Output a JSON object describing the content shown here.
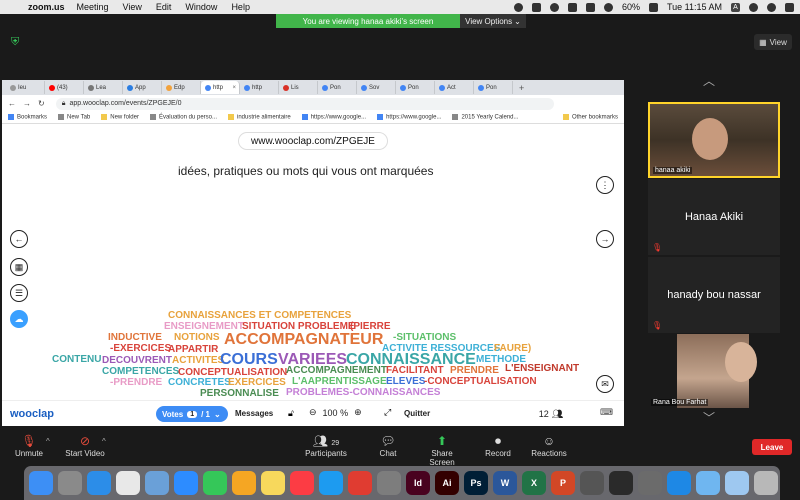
{
  "menubar": {
    "app": "zoom.us",
    "items": [
      "Meeting",
      "View",
      "Edit",
      "Window",
      "Help"
    ],
    "battery": "60%",
    "clock": "Tue 11:15 AM"
  },
  "zoom": {
    "share_banner": "You are viewing hanaa akiki's screen",
    "view_options": "View Options",
    "view_button": "View",
    "participants_count": "29",
    "controls": {
      "unmute": "Unmute",
      "start_video": "Start Video",
      "participants": "Participants",
      "chat": "Chat",
      "share_screen": "Share Screen",
      "record": "Record",
      "reactions": "Reactions",
      "leave": "Leave"
    },
    "tiles": [
      {
        "name": "hanaa akiki"
      },
      {
        "name": "Hanaa Akiki"
      },
      {
        "name": "hanady bou nassar"
      },
      {
        "name": "Rana Bou Farhat"
      }
    ]
  },
  "browser": {
    "tabs": [
      "(43)",
      "Lea",
      "App",
      "Edp",
      "http",
      "http",
      "Lis",
      "Pon",
      "Sov",
      "Pon",
      "Act",
      "Pon"
    ],
    "first_tab": "Ieu",
    "url": "app.wooclap.com/events/ZPGEJE/0",
    "bookmarks": [
      "Bookmarks",
      "New Tab",
      "New folder",
      "Évaluation du perso...",
      "industrie alimentaire",
      "https://www.google...",
      "https://www.google...",
      "2015 Yearly Calend..."
    ],
    "other_bookmarks": "Other bookmarks"
  },
  "wooclap": {
    "pill_url": "www.wooclap.com/ZPGEJE",
    "question": "idées, pratiques ou mots qui vous ont marquées",
    "logo": "wooclap",
    "votes_label": "Votes",
    "page_current": "1",
    "page_total": "/ 1",
    "messages": "Messages",
    "zoom_level": "100 %",
    "quit": "Quitter",
    "participants": "12"
  },
  "wordcloud": [
    {
      "text": "CONNAISSANCES ET COMPETENCES",
      "color": "#e8a23c"
    },
    {
      "text": "ENSEIGNEMENT",
      "color": "#e89bc6"
    },
    {
      "text": "SITUATION PROBLEME",
      "color": "#d8433b"
    },
    {
      "text": "(PIERRE",
      "color": "#d8433b"
    },
    {
      "text": "INDUCTIVE",
      "color": "#e0743a"
    },
    {
      "text": "NOTIONS",
      "color": "#e8a23c"
    },
    {
      "text": "ACCOMPAGNATEUR",
      "color": "#e0743a"
    },
    {
      "text": "-SITUATIONS",
      "color": "#5cbf6a"
    },
    {
      "text": "-EXERCICES",
      "color": "#d8433b"
    },
    {
      "text": "APPARTIR",
      "color": "#d8433b"
    },
    {
      "text": "ACTIVITE RESSOURCES",
      "color": "#3db0d6"
    },
    {
      "text": "FAURE)",
      "color": "#e8a23c"
    },
    {
      "text": "CONTENU",
      "color": "#3aa6a6"
    },
    {
      "text": "DECOUVRENT",
      "color": "#9b59b6"
    },
    {
      "text": "ACTIVITES",
      "color": "#e8a23c"
    },
    {
      "text": "COURS",
      "color": "#3b6fd6"
    },
    {
      "text": "VARIEES",
      "color": "#9b59b6"
    },
    {
      "text": "CONNAISSANCE",
      "color": "#3aa6a6"
    },
    {
      "text": "METHODE",
      "color": "#3db0d6"
    },
    {
      "text": "COMPETENCES",
      "color": "#3aa6a6"
    },
    {
      "text": "CONCEPTUALISATION",
      "color": "#d8433b"
    },
    {
      "text": "ACCOMPAGNEMENT",
      "color": "#4a8c52"
    },
    {
      "text": "FACILITANT",
      "color": "#d8433b"
    },
    {
      "text": "PRENDRE",
      "color": "#e0743a"
    },
    {
      "text": "L'ENSEIGNANT",
      "color": "#c0392b"
    },
    {
      "text": "-PRENDRE",
      "color": "#e89bc6"
    },
    {
      "text": "CONCRETES",
      "color": "#3db0d6"
    },
    {
      "text": "EXERCICES",
      "color": "#e8a23c"
    },
    {
      "text": "L'AAPRENTISSAGE",
      "color": "#5cbf6a"
    },
    {
      "text": "ELEVES",
      "color": "#3b6fd6"
    },
    {
      "text": "-CONCEPTUALISATION",
      "color": "#d8433b"
    },
    {
      "text": "PERSONNALISE",
      "color": "#4a8c52"
    },
    {
      "text": "PROBLEMES-CONNAISSANCES",
      "color": "#c47fd6"
    }
  ],
  "dock": [
    {
      "icon": "finder-icon",
      "color": "#3d8ff5"
    },
    {
      "icon": "launchpad-icon",
      "color": "#8a8a8a"
    },
    {
      "icon": "safari-icon",
      "color": "#2c8de8"
    },
    {
      "icon": "chrome-icon",
      "color": "#e8e8e8"
    },
    {
      "icon": "preview-icon",
      "color": "#6aa0d8"
    },
    {
      "icon": "zoom-icon",
      "color": "#2d8cff"
    },
    {
      "icon": "facetime-icon",
      "color": "#35c759"
    },
    {
      "icon": "photos-icon",
      "color": "#f5a623"
    },
    {
      "icon": "notes-icon",
      "color": "#f7d85c"
    },
    {
      "icon": "music-icon",
      "color": "#fc3c44"
    },
    {
      "icon": "appstore-icon",
      "color": "#1d9bf0"
    },
    {
      "icon": "anydesk-icon",
      "color": "#e03c31"
    },
    {
      "icon": "settings-icon",
      "color": "#7d7d7d"
    },
    {
      "icon": "indesign-icon",
      "color": "#49021f",
      "label": "Id"
    },
    {
      "icon": "illustrator-icon",
      "color": "#330000",
      "label": "Ai"
    },
    {
      "icon": "photoshop-icon",
      "color": "#001e36",
      "label": "Ps"
    },
    {
      "icon": "word-icon",
      "color": "#2b579a",
      "label": "W"
    },
    {
      "icon": "excel-icon",
      "color": "#217346",
      "label": "X"
    },
    {
      "icon": "powerpoint-icon",
      "color": "#d24726",
      "label": "P"
    },
    {
      "icon": "game-icon",
      "color": "#555555"
    },
    {
      "icon": "quicktime-icon",
      "color": "#2a2a2a"
    },
    {
      "icon": "camera-icon",
      "color": "#6b6b6b"
    },
    {
      "icon": "accessibility-icon",
      "color": "#1e88e5"
    },
    {
      "icon": "folder-icon",
      "color": "#6fb6f0"
    },
    {
      "icon": "downloads-icon",
      "color": "#9ec8f0"
    },
    {
      "icon": "trash-icon",
      "color": "#b8b8b8"
    }
  ]
}
